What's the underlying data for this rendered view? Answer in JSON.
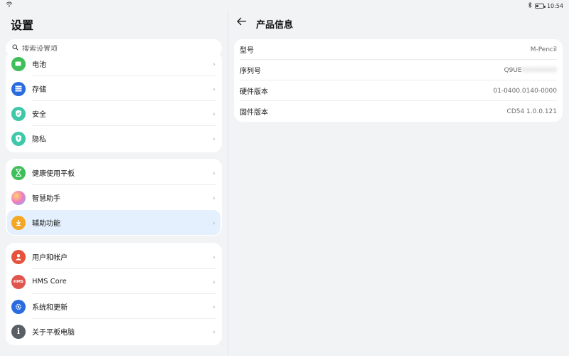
{
  "status_bar": {
    "time": "10:54",
    "wifi_icon": "wifi-icon",
    "bluetooth_icon": "bluetooth-icon",
    "battery_icon": "battery-icon"
  },
  "left": {
    "title": "设置",
    "search_placeholder": "搜索设置项",
    "groups": [
      {
        "items": [
          {
            "label": "电池",
            "icon": "battery-icon",
            "color": "#3fbf5a"
          },
          {
            "label": "存储",
            "icon": "storage-icon",
            "color": "#2a6be0"
          },
          {
            "label": "安全",
            "icon": "shield-icon",
            "color": "#3ec8a8"
          },
          {
            "label": "隐私",
            "icon": "privacy-icon",
            "color": "#3ec8a8"
          }
        ]
      },
      {
        "items": [
          {
            "label": "健康使用平板",
            "icon": "hourglass-icon",
            "color": "#3fbf5a"
          },
          {
            "label": "智慧助手",
            "icon": "assistant-icon",
            "color": "#e07ad0"
          },
          {
            "label": "辅助功能",
            "icon": "hand-icon",
            "color": "#f5a623",
            "active": true
          }
        ]
      },
      {
        "items": [
          {
            "label": "用户和帐户",
            "icon": "user-icon",
            "color": "#e5533d"
          },
          {
            "label": "HMS Core",
            "icon": "hms-icon",
            "color": "#e0564f",
            "icon_text": "HMS"
          },
          {
            "label": "系统和更新",
            "icon": "gear-icon",
            "color": "#2a6be0"
          },
          {
            "label": "关于平板电脑",
            "icon": "info-icon",
            "color": "#5a5f66"
          }
        ]
      }
    ]
  },
  "right": {
    "title": "产品信息",
    "back_icon": "back-arrow-icon",
    "rows": [
      {
        "key": "型号",
        "value": "M-Pencil"
      },
      {
        "key": "序列号",
        "value": "Q9UE",
        "value_redacted": "XXXXXXXX"
      },
      {
        "key": "硬件版本",
        "value": "01-0400.0140-0000"
      },
      {
        "key": "固件版本",
        "value": "CD54 1.0.0.121"
      }
    ]
  }
}
